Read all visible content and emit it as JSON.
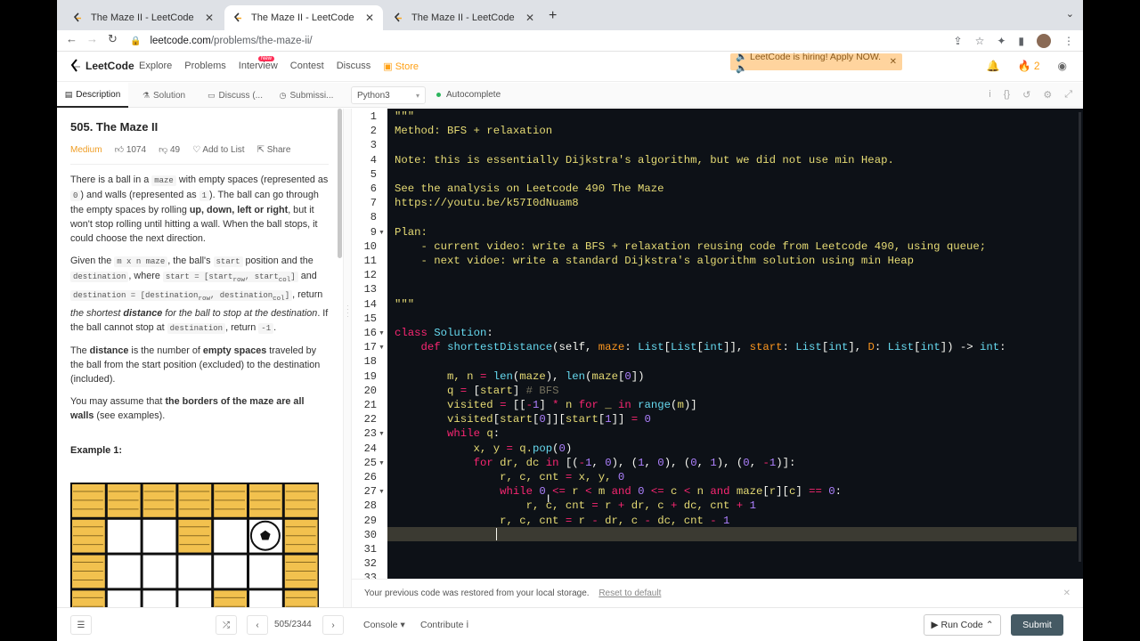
{
  "browser": {
    "tabs": [
      {
        "title": "The Maze II - LeetCode",
        "active": false
      },
      {
        "title": "The Maze II - LeetCode",
        "active": true
      },
      {
        "title": "The Maze II - LeetCode",
        "active": false
      }
    ],
    "url_host": "leetcode.com",
    "url_path": "/problems/the-maze-ii/"
  },
  "nav": {
    "logo": "LeetCode",
    "items": [
      "Explore",
      "Problems",
      "Interview",
      "Contest",
      "Discuss",
      "Store"
    ],
    "new_badge": "New",
    "hiring": "🔈 LeetCode is hiring! Apply NOW.🔈",
    "streak": "2"
  },
  "subbar": {
    "tabs": [
      "Description",
      "Solution",
      "Discuss (...",
      "Submissi..."
    ],
    "language": "Python3",
    "autocomplete": "Autocomplete"
  },
  "problem": {
    "title": "505. The Maze II",
    "difficulty": "Medium",
    "likes": "1074",
    "dislikes": "49",
    "add_to_list": "Add to List",
    "share": "Share",
    "example_label": "Example 1:"
  },
  "editor": {
    "line_count": 33,
    "current_line": 30
  },
  "footer": {
    "restored": "Your previous code was restored from your local storage.",
    "reset": "Reset to default",
    "page": "505/2344",
    "console": "Console",
    "contribute": "Contribute",
    "run": "Run Code",
    "submit": "Submit"
  },
  "colors": {
    "accent": "#ffa116",
    "editor_bg": "#0d1117",
    "difficulty": "#ef9d24"
  }
}
